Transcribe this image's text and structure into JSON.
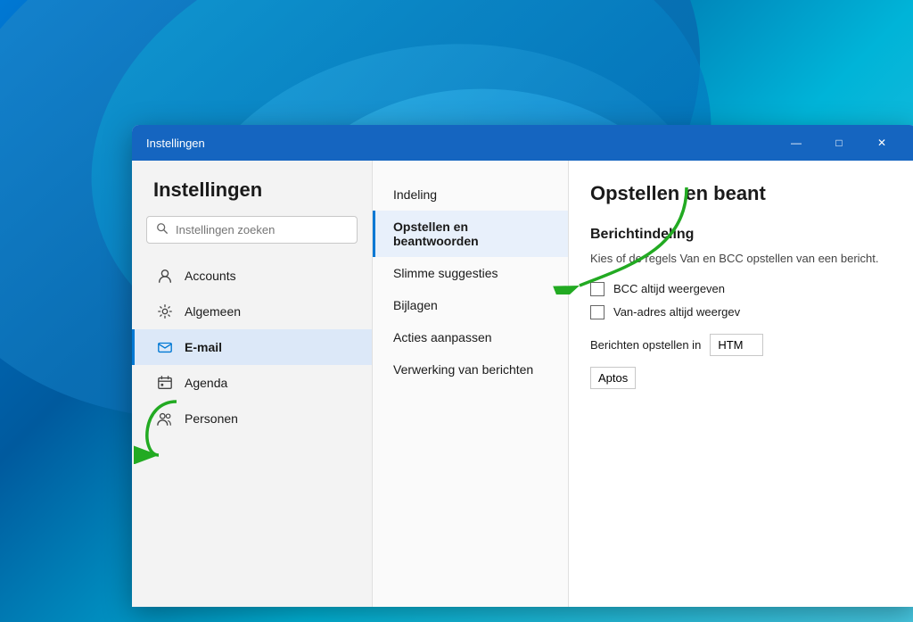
{
  "wallpaper": {
    "alt": "Windows 11 blue wave wallpaper"
  },
  "window": {
    "title": "Instellingen",
    "controls": {
      "minimize": "—",
      "maximize": "□",
      "close": "✕"
    }
  },
  "sidebar": {
    "title": "Instellingen",
    "search": {
      "placeholder": "Instellingen zoeken"
    },
    "nav_items": [
      {
        "id": "accounts",
        "label": "Accounts",
        "icon": "person"
      },
      {
        "id": "algemeen",
        "label": "Algemeen",
        "icon": "gear"
      },
      {
        "id": "email",
        "label": "E-mail",
        "icon": "email",
        "active": true
      },
      {
        "id": "agenda",
        "label": "Agenda",
        "icon": "calendar"
      },
      {
        "id": "personen",
        "label": "Personen",
        "icon": "people"
      }
    ]
  },
  "middle_panel": {
    "items": [
      {
        "id": "indeling",
        "label": "Indeling",
        "active": false
      },
      {
        "id": "opstellen",
        "label": "Opstellen en beantwoorden",
        "active": true
      },
      {
        "id": "suggesties",
        "label": "Slimme suggesties",
        "active": false
      },
      {
        "id": "bijlagen",
        "label": "Bijlagen",
        "active": false
      },
      {
        "id": "acties",
        "label": "Acties aanpassen",
        "active": false
      },
      {
        "id": "verwerking",
        "label": "Verwerking van berichten",
        "active": false
      }
    ]
  },
  "right_panel": {
    "title": "Opstellen en beant",
    "section_title": "Berichtindeling",
    "section_desc": "Kies of de regels Van en BCC opstellen van een bericht.",
    "checkboxes": [
      {
        "id": "bcc",
        "label": "BCC altijd weergeven",
        "checked": false
      },
      {
        "id": "van",
        "label": "Van-adres altijd weergev",
        "checked": false
      }
    ],
    "format_row": {
      "label": "Berichten opstellen in",
      "value": "HTM"
    },
    "font_value": "Aptos"
  },
  "arrows": {
    "arrow1": {
      "direction": "right",
      "color": "#22aa22"
    },
    "arrow2": {
      "direction": "down-left",
      "color": "#22aa22"
    }
  }
}
